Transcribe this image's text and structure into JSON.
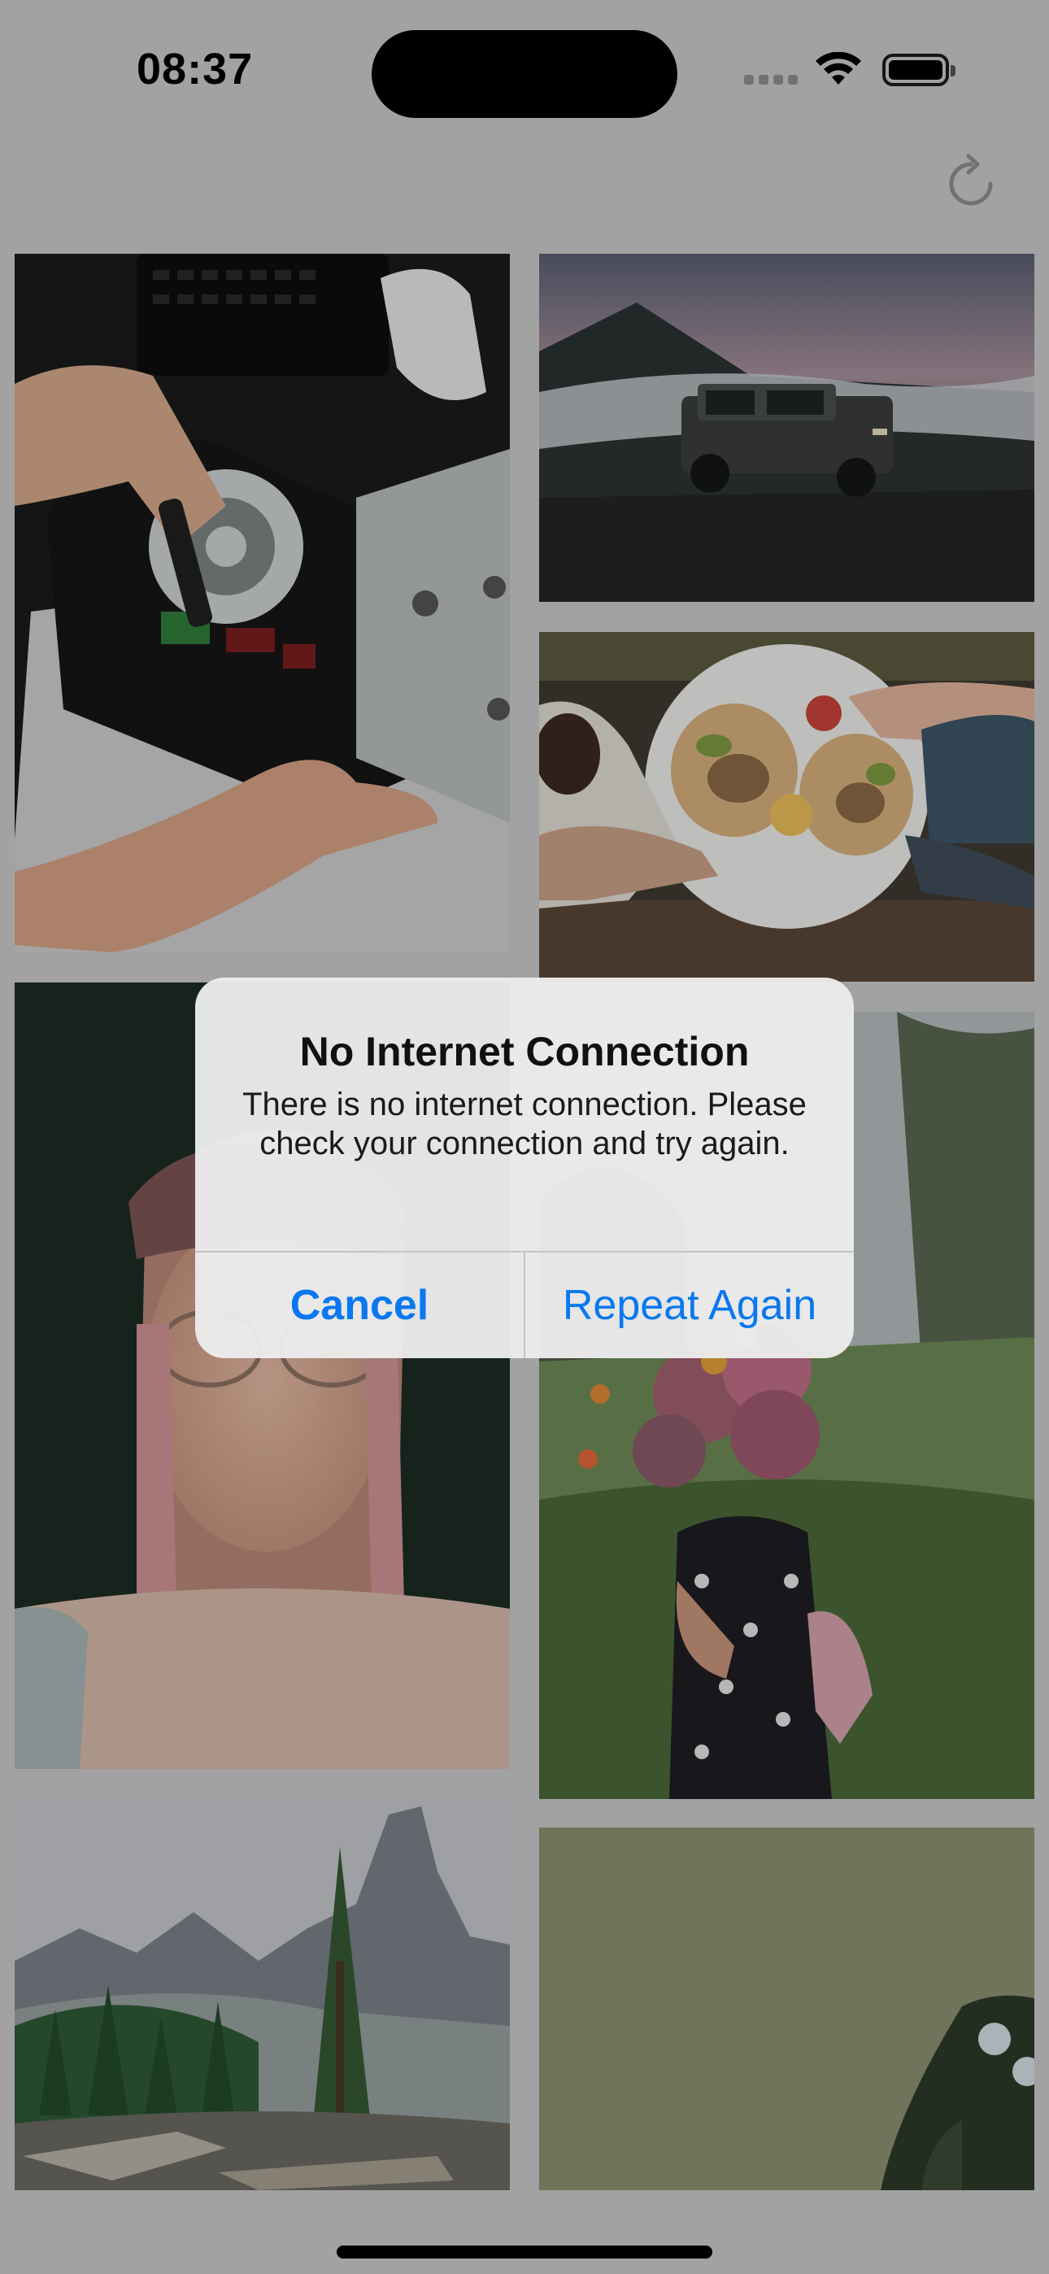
{
  "status_bar": {
    "time": "08:37"
  },
  "nav": {
    "refresh_icon": "refresh-icon"
  },
  "gallery": {
    "photos": [
      {
        "name": "photo-console-repair"
      },
      {
        "name": "photo-suv-mountains"
      },
      {
        "name": "photo-breakfast-table"
      },
      {
        "name": "photo-woman-glasses"
      },
      {
        "name": "photo-woman-flowers"
      },
      {
        "name": "photo-mountain-lake"
      },
      {
        "name": "photo-green-blur"
      }
    ]
  },
  "alert": {
    "title": "No Internet Connection",
    "message": "There is no internet connection. Please check your connection and try again.",
    "cancel_label": "Cancel",
    "repeat_label": "Repeat Again"
  },
  "colors": {
    "accent": "#0a78f0",
    "background": "#cbcbcb"
  }
}
